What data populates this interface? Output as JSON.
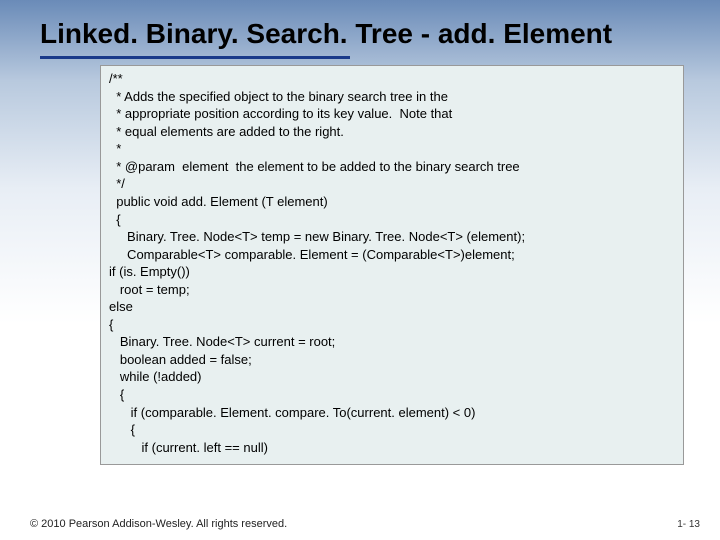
{
  "title": "Linked. Binary. Search. Tree - add. Element",
  "code_block1": "/**\n  * Adds the specified object to the binary search tree in the\n  * appropriate position according to its key value.  Note that\n  * equal elements are added to the right.\n  *\n  * @param  element  the element to be added to the binary search tree\n  */\n  public void add. Element (T element)\n  {\n     Binary. Tree. Node<T> temp = new Binary. Tree. Node<T> (element);\n     Comparable<T> comparable. Element = (Comparable<T>)element;",
  "code_block2": "if (is. Empty())\n   root = temp;\nelse\n{\n   Binary. Tree. Node<T> current = root;\n   boolean added = false;\n   while (!added)\n   {\n      if (comparable. Element. compare. To(current. element) < 0)\n      {\n         if (current. left == null)",
  "footer": "© 2010 Pearson Addison-Wesley. All rights reserved.",
  "page_number": "1- 13"
}
